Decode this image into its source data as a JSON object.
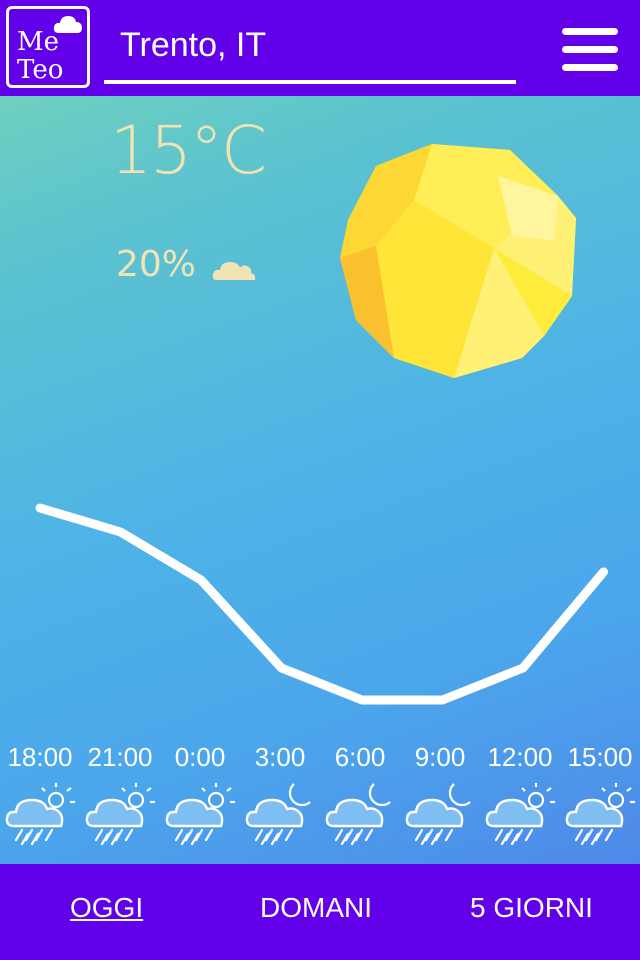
{
  "header": {
    "logo_line1": "Me",
    "logo_line2": "Teo",
    "city": "Trento, IT"
  },
  "current": {
    "temperature": "15°C",
    "precipitation": "20%"
  },
  "colors": {
    "bar": "#6200ea",
    "accent_text": "#f1e3b4",
    "line": "#ffffff",
    "sun_main": "#ffeb3b",
    "sun_shade": "#fdd835"
  },
  "forecast": [
    {
      "time": "18:00",
      "icon": "rain-sun-icon"
    },
    {
      "time": "21:00",
      "icon": "rain-sun-icon"
    },
    {
      "time": "0:00",
      "icon": "rain-sun-icon"
    },
    {
      "time": "3:00",
      "icon": "rain-moon-icon"
    },
    {
      "time": "6:00",
      "icon": "rain-moon-icon"
    },
    {
      "time": "9:00",
      "icon": "rain-moon-icon"
    },
    {
      "time": "12:00",
      "icon": "rain-sun-icon"
    },
    {
      "time": "15:00",
      "icon": "rain-sun-icon"
    }
  ],
  "chart_data": {
    "type": "line",
    "x": [
      "18:00",
      "21:00",
      "0:00",
      "3:00",
      "6:00",
      "9:00",
      "12:00",
      "15:00"
    ],
    "values": [
      15,
      13.5,
      10.5,
      5,
      3,
      3,
      5,
      11
    ],
    "ylim": [
      0,
      20
    ],
    "grid": false
  },
  "tabs": [
    {
      "label": "OGGI",
      "active": true
    },
    {
      "label": "DOMANI",
      "active": false
    },
    {
      "label": "5 GIORNI",
      "active": false
    }
  ]
}
